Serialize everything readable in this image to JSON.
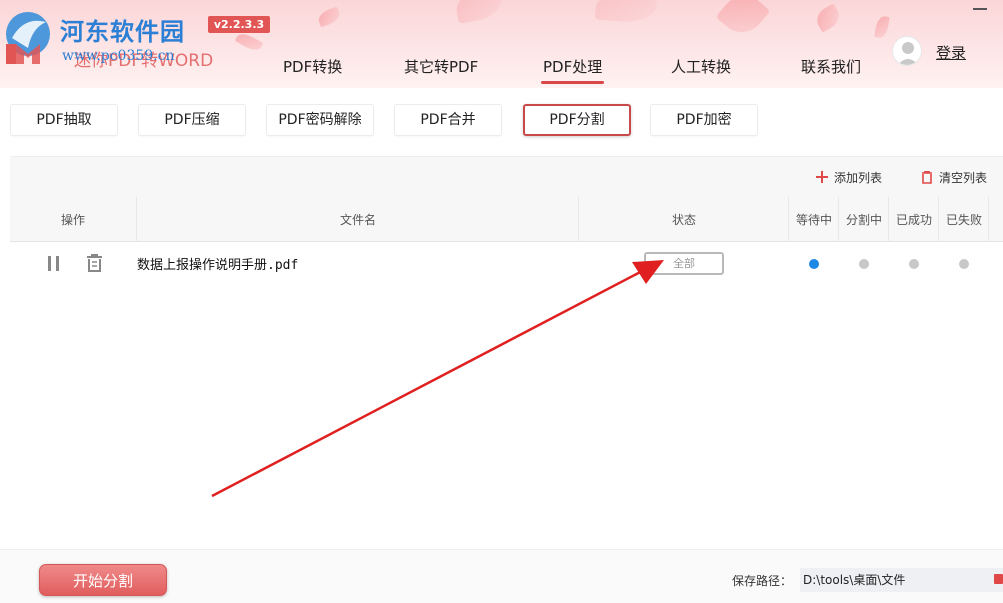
{
  "header": {
    "site_title": "河东软件园",
    "site_url": "www.pc0359.cn",
    "app_name": "迷你PDF转WORD",
    "version": "v2.2.3.3",
    "login_label": "登录",
    "nav": [
      {
        "label": "PDF转换"
      },
      {
        "label": "其它转PDF"
      },
      {
        "label": "PDF处理"
      },
      {
        "label": "人工转换"
      },
      {
        "label": "联系我们"
      }
    ],
    "active_nav": "PDF处理"
  },
  "subtabs": [
    {
      "label": "PDF抽取"
    },
    {
      "label": "PDF压缩"
    },
    {
      "label": "PDF密码解除"
    },
    {
      "label": "PDF合并"
    },
    {
      "label": "PDF分割"
    },
    {
      "label": "PDF加密"
    }
  ],
  "active_subtab": "PDF分割",
  "toolbar": {
    "add_list": "添加列表",
    "clear_list": "清空列表"
  },
  "table": {
    "headers": {
      "action": "操作",
      "filename": "文件名",
      "status": "状态",
      "waiting": "等待中",
      "splitting": "分割中",
      "success": "已成功",
      "failed": "已失败"
    },
    "rows": [
      {
        "filename": "数据上报操作说明手册.pdf",
        "status_select": "全部",
        "state": "waiting"
      }
    ]
  },
  "footer": {
    "start_button": "开始分割",
    "save_path_label": "保存路径：",
    "save_path_value": "D:\\tools\\桌面\\文件"
  },
  "colors": {
    "accent": "#d94848",
    "brand_blue": "#2b7fd4",
    "waiting_dot": "#1e88e5",
    "idle_dot": "#c8c8c8",
    "annotation_arrow": "#e02020"
  }
}
